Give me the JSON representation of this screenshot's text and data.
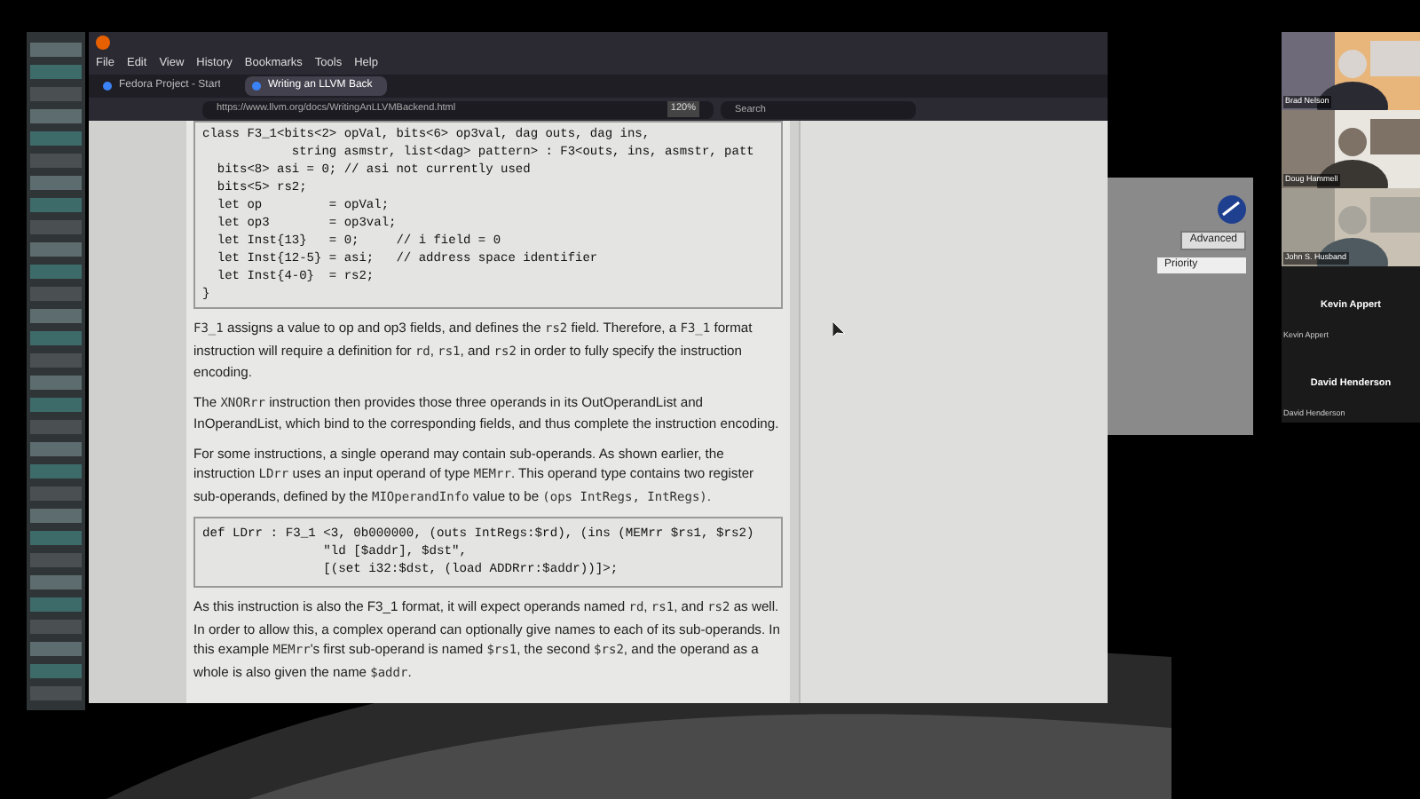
{
  "browser": {
    "menu": [
      "File",
      "Edit",
      "View",
      "History",
      "Bookmarks",
      "Tools",
      "Help"
    ],
    "tabs": [
      {
        "label": "Fedora Project - Start",
        "selected": false
      },
      {
        "label": "Writing an LLVM Back",
        "selected": true
      }
    ],
    "url": "https://www.llvm.org/docs/WritingAnLLVMBackend.html",
    "zoom": "120%",
    "search": {
      "placeholder": "Search"
    }
  },
  "page": {
    "code_1": [
      "class F3_1<bits<2> opVal, bits<6> op3val, dag outs, dag ins,",
      "            string asmstr, list<dag> pattern> : F3<outs, ins, asmstr, patt",
      "  bits<8> asi = 0; // asi not currently used",
      "  bits<5> rs2;",
      "  let op         = opVal;",
      "  let op3        = op3val;",
      "  let Inst{13}   = 0;     // i field = 0",
      "  let Inst{12-5} = asi;   // address space identifier",
      "  let Inst{4-0}  = rs2;",
      "}"
    ],
    "paragraphs_1": [
      [
        {
          "kind": "code",
          "text": "F3_1"
        },
        {
          "kind": "text",
          "text": " assigns a value to op and op3 fields, and defines the "
        },
        {
          "kind": "code",
          "text": "rs2"
        },
        {
          "kind": "text",
          "text": " field. Therefore, a "
        },
        {
          "kind": "code",
          "text": "F3_1"
        },
        {
          "kind": "text",
          "text": " format instruction will require a definition for "
        },
        {
          "kind": "code",
          "text": "rd"
        },
        {
          "kind": "text",
          "text": ", "
        },
        {
          "kind": "code",
          "text": "rs1"
        },
        {
          "kind": "text",
          "text": ", and "
        },
        {
          "kind": "code",
          "text": "rs2"
        },
        {
          "kind": "text",
          "text": " in order to fully specify the instruction encoding."
        }
      ],
      [
        {
          "kind": "text",
          "text": "The "
        },
        {
          "kind": "code",
          "text": "XNORrr"
        },
        {
          "kind": "text",
          "text": " instruction then provides those three operands in its OutOperandList and InOperandList, which bind to the corresponding fields, and thus complete the instruction encoding."
        }
      ],
      [
        {
          "kind": "text",
          "text": "For some instructions, a single operand may contain sub-operands. As shown earlier, the instruction "
        },
        {
          "kind": "code",
          "text": "LDrr"
        },
        {
          "kind": "text",
          "text": " uses an input operand of type "
        },
        {
          "kind": "code",
          "text": "MEMrr"
        },
        {
          "kind": "text",
          "text": ". This operand type contains two register sub-operands, defined by the "
        },
        {
          "kind": "code",
          "text": "MIOperandInfo"
        },
        {
          "kind": "text",
          "text": " value to be "
        },
        {
          "kind": "code",
          "text": "(ops IntRegs, IntRegs)"
        },
        {
          "kind": "text",
          "text": "."
        }
      ]
    ],
    "code_2": [
      "def LDrr : F3_1 <3, 0b000000, (outs IntRegs:$rd), (ins (MEMrr $rs1, $rs2)",
      "                \"ld [$addr], $dst\",",
      "                [(set i32:$dst, (load ADDRrr:$addr))]>;"
    ],
    "paragraphs_2": [
      [
        {
          "kind": "text",
          "text": "As this instruction is also the F3_1 format, it will expect operands named "
        },
        {
          "kind": "code",
          "text": "rd"
        },
        {
          "kind": "text",
          "text": ", "
        },
        {
          "kind": "code",
          "text": "rs1"
        },
        {
          "kind": "text",
          "text": ", and "
        },
        {
          "kind": "code",
          "text": "rs2"
        },
        {
          "kind": "text",
          "text": " as well. In order to allow this, a complex operand can optionally give names to each of its sub-operands. In this example "
        },
        {
          "kind": "code",
          "text": "MEMrr"
        },
        {
          "kind": "text",
          "text": "'s first sub-operand is named "
        },
        {
          "kind": "code",
          "text": "$rs1"
        },
        {
          "kind": "text",
          "text": ", the second "
        },
        {
          "kind": "code",
          "text": "$rs2"
        },
        {
          "kind": "text",
          "text": ", and the operand as a whole is also given the name "
        },
        {
          "kind": "code",
          "text": "$addr"
        },
        {
          "kind": "text",
          "text": "."
        }
      ]
    ]
  },
  "back_window": {
    "button": "Advanced",
    "column": "Priority"
  },
  "participants": [
    {
      "kind": "video",
      "name": "Brad Nelson"
    },
    {
      "kind": "video",
      "name": "Doug Hammell"
    },
    {
      "kind": "video",
      "name": "John S. Husband"
    },
    {
      "kind": "avatar",
      "display": "Kevin Appert",
      "name": "Kevin Appert"
    },
    {
      "kind": "avatar",
      "display": "David Henderson",
      "name": "David Henderson"
    }
  ]
}
